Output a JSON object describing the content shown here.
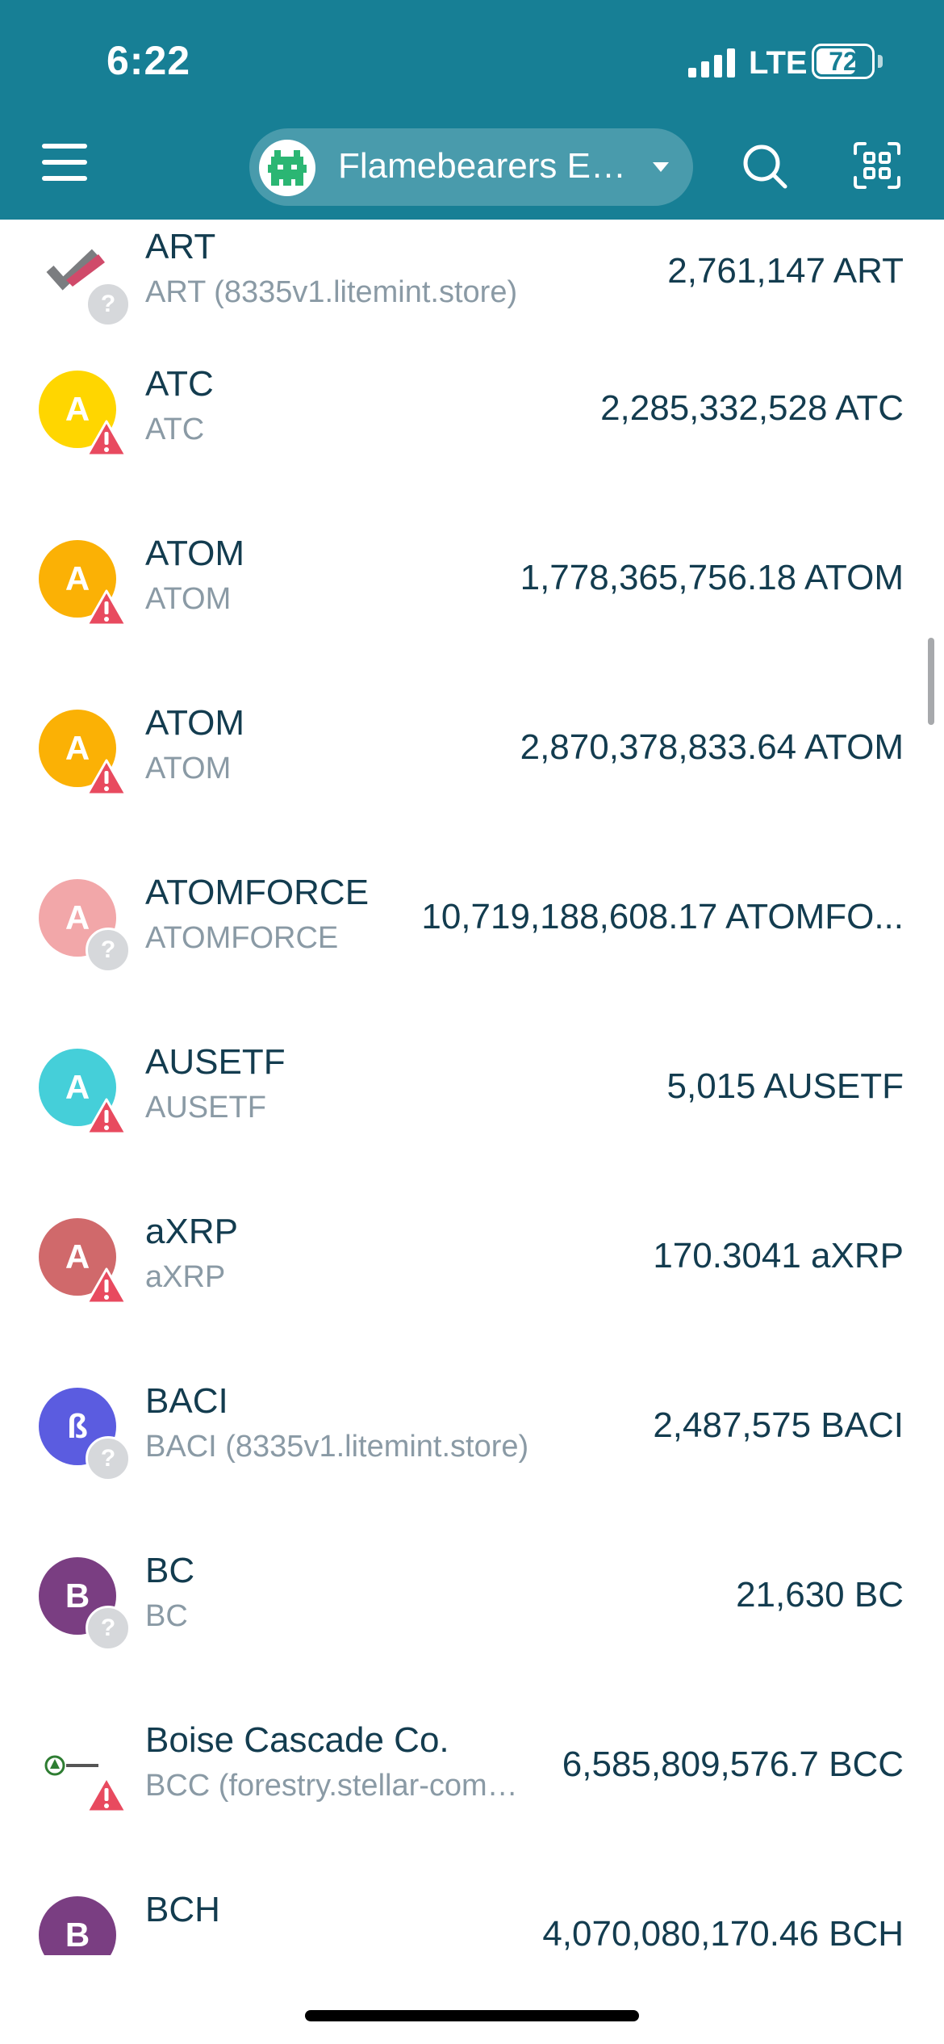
{
  "status_bar": {
    "time": "6:22",
    "network": "LTE",
    "battery": "72",
    "battery_level": 0.72
  },
  "header": {
    "wallet_name": "Flamebearers E…"
  },
  "colors": {
    "accent": "#177f95",
    "text": "#133c4f",
    "muted": "#8a9aa5",
    "warning": "#e84a5f"
  },
  "assets": [
    {
      "name": "ART",
      "sub": "ART (8335v1.litemint.store)",
      "amount": "2,761,147 ART",
      "icon_letter": "",
      "icon": "art-logo-icon",
      "color": "#ffffff",
      "badge": "question"
    },
    {
      "name": "ATC",
      "sub": "ATC",
      "amount": "2,285,332,528 ATC",
      "icon_letter": "A",
      "icon": "letter-a-icon",
      "color": "#ffd600",
      "badge": "warning"
    },
    {
      "name": "ATOM",
      "sub": "ATOM",
      "amount": "1,778,365,756.18 ATOM",
      "icon_letter": "A",
      "icon": "letter-a-icon",
      "color": "#fbb105",
      "badge": "warning"
    },
    {
      "name": "ATOM",
      "sub": "ATOM",
      "amount": "2,870,378,833.64 ATOM",
      "icon_letter": "A",
      "icon": "letter-a-icon",
      "color": "#fbb105",
      "badge": "warning"
    },
    {
      "name": "ATOMFORCE",
      "sub": "ATOMFORCE",
      "amount": "10,719,188,608.17 ATOMFO...",
      "icon_letter": "A",
      "icon": "letter-a-icon",
      "color": "#f2a7a9",
      "badge": "question"
    },
    {
      "name": "AUSETF",
      "sub": "AUSETF",
      "amount": "5,015 AUSETF",
      "icon_letter": "A",
      "icon": "letter-a-icon",
      "color": "#45cfd9",
      "badge": "warning"
    },
    {
      "name": "aXRP",
      "sub": "aXRP",
      "amount": "170.3041 aXRP",
      "icon_letter": "A",
      "icon": "letter-a-icon",
      "color": "#d0696b",
      "badge": "warning"
    },
    {
      "name": "BACI",
      "sub": "BACI (8335v1.litemint.store)",
      "amount": "2,487,575 BACI",
      "icon_letter": "ß",
      "icon": "baci-logo-icon",
      "color": "#5b5ce0",
      "badge": "question"
    },
    {
      "name": "BC",
      "sub": "BC",
      "amount": "21,630 BC",
      "icon_letter": "B",
      "icon": "letter-b-icon",
      "color": "#7a3e82",
      "badge": "question"
    },
    {
      "name": "Boise Cascade Co.",
      "sub": "BCC (forestry.stellar-com…",
      "amount": "6,585,809,576.7 BCC",
      "icon_letter": "",
      "icon": "boise-cascade-logo-icon",
      "color": "#ffffff",
      "badge": "warning"
    },
    {
      "name": "BCH",
      "sub": "",
      "amount": "4,070,080,170.46 BCH",
      "icon_letter": "B",
      "icon": "letter-b-icon",
      "color": "#7a3e82",
      "badge": "none"
    }
  ]
}
